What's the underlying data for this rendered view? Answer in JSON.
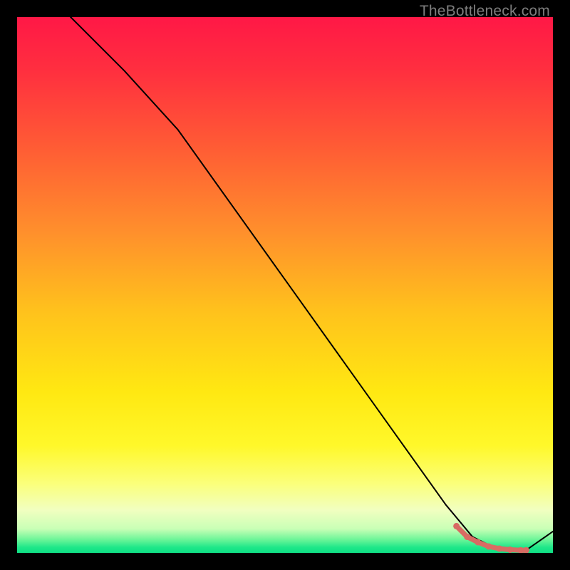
{
  "watermark": "TheBottleneck.com",
  "colors": {
    "frame": "#000000",
    "line": "#000000",
    "marker": "#d86b63",
    "watermark": "#7d7d7d",
    "gradient_stops": [
      {
        "offset": 0.0,
        "color": "#ff1846"
      },
      {
        "offset": 0.1,
        "color": "#ff2f3f"
      },
      {
        "offset": 0.25,
        "color": "#ff5e34"
      },
      {
        "offset": 0.4,
        "color": "#ff8f2c"
      },
      {
        "offset": 0.55,
        "color": "#ffc21c"
      },
      {
        "offset": 0.7,
        "color": "#ffe812"
      },
      {
        "offset": 0.8,
        "color": "#fff82a"
      },
      {
        "offset": 0.87,
        "color": "#fbff7a"
      },
      {
        "offset": 0.92,
        "color": "#f1ffc0"
      },
      {
        "offset": 0.955,
        "color": "#c9ffb6"
      },
      {
        "offset": 0.975,
        "color": "#6cf598"
      },
      {
        "offset": 0.99,
        "color": "#1de789"
      },
      {
        "offset": 1.0,
        "color": "#0fdf84"
      }
    ]
  },
  "chart_data": {
    "type": "line",
    "title": "",
    "xlabel": "",
    "ylabel": "",
    "xlim": [
      0,
      100
    ],
    "ylim": [
      0,
      100
    ],
    "series": [
      {
        "name": "bottleneck-curve",
        "x": [
          0,
          10,
          20,
          30,
          40,
          50,
          60,
          70,
          80,
          85,
          90,
          95,
          100
        ],
        "values": [
          110,
          100,
          90,
          79,
          65,
          51,
          37,
          23,
          9,
          3,
          0.5,
          0.5,
          4
        ]
      }
    ],
    "markers": {
      "name": "highlight-segment",
      "x": [
        82,
        84,
        86,
        88,
        90,
        92,
        94,
        95
      ],
      "values": [
        5,
        3,
        2,
        1.2,
        0.8,
        0.6,
        0.5,
        0.5
      ]
    }
  }
}
